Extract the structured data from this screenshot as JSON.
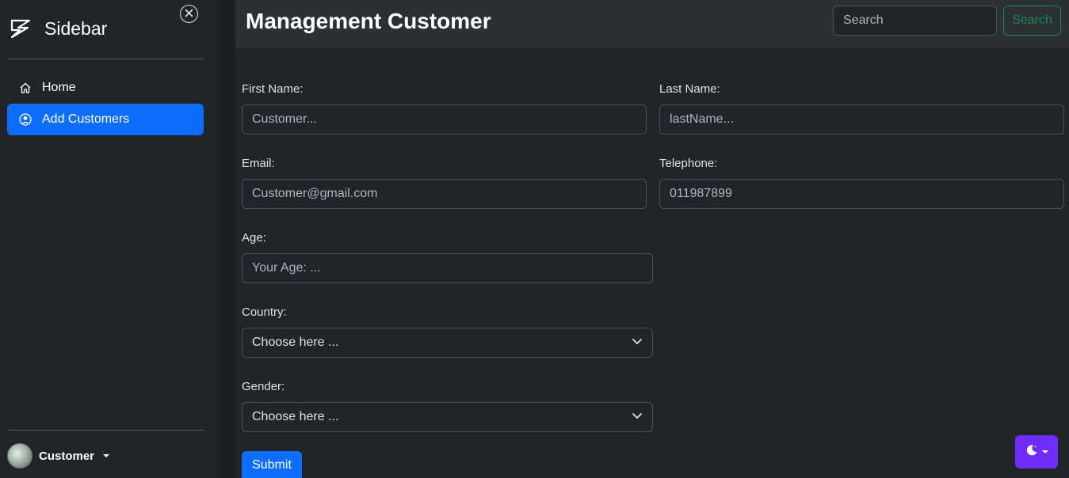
{
  "sidebar": {
    "brand": "Sidebar",
    "nav": [
      {
        "label": "Home",
        "icon": "home-icon",
        "active": false
      },
      {
        "label": "Add Customers",
        "icon": "user-circle-icon",
        "active": true
      }
    ],
    "user": {
      "name": "Customer"
    }
  },
  "header": {
    "title": "Management Customer",
    "search_placeholder": "Search",
    "search_button": "Search"
  },
  "form": {
    "first_name": {
      "label": "First Name:",
      "placeholder": "Customer..."
    },
    "last_name": {
      "label": "Last Name:",
      "placeholder": "lastName..."
    },
    "email": {
      "label": "Email:",
      "placeholder": "Customer@gmail.com"
    },
    "telephone": {
      "label": "Telephone:",
      "placeholder": "011987899"
    },
    "age": {
      "label": "Age:",
      "placeholder": "Your Age: ..."
    },
    "country": {
      "label": "Country:",
      "selected": "Choose here ..."
    },
    "gender": {
      "label": "Gender:",
      "selected": "Choose here ..."
    },
    "submit": "Submit"
  },
  "theme": {
    "icon": "moon-icon"
  },
  "colors": {
    "accent": "#0d6efd",
    "success": "#198754",
    "theme_button": "#712cf9",
    "background": "#212529"
  }
}
